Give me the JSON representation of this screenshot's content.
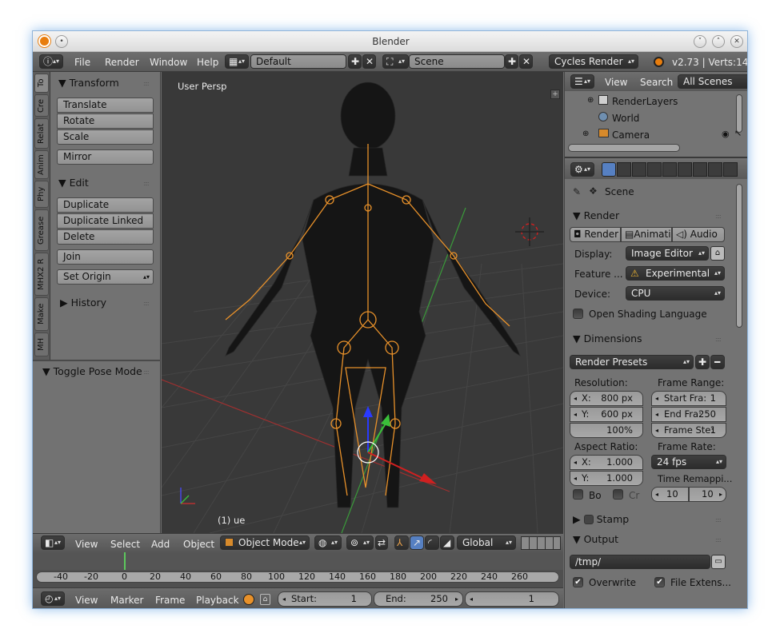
{
  "window": {
    "title": "Blender"
  },
  "info_header": {
    "menus": [
      "File",
      "Render",
      "Window",
      "Help"
    ],
    "layout": "Default",
    "scene": "Scene",
    "engine": "Cycles Render",
    "version_stats": "v2.73 | Verts:14,4"
  },
  "left_tabs": [
    "To",
    "Cre",
    "Relat",
    "Anim",
    "Phy",
    "Grease",
    "MHX2 R",
    "Make",
    "MH"
  ],
  "tool_shelf": {
    "transform_title": "Transform",
    "transform_buttons": [
      "Translate",
      "Rotate",
      "Scale"
    ],
    "mirror": "Mirror",
    "edit_title": "Edit",
    "edit_buttons": [
      "Duplicate",
      "Duplicate Linked",
      "Delete"
    ],
    "join": "Join",
    "set_origin": "Set Origin",
    "history": "History",
    "toggle_pose": "Toggle Pose Mode"
  },
  "viewport": {
    "label": "User Persp",
    "object_label": "(1) ue"
  },
  "viewport_header": {
    "menus": [
      "View",
      "Select",
      "Add",
      "Object"
    ],
    "mode": "Object Mode",
    "orientation": "Global"
  },
  "timeline": {
    "ticks": [
      "-40",
      "-20",
      "0",
      "20",
      "40",
      "60",
      "80",
      "100",
      "120",
      "140",
      "160",
      "180",
      "200",
      "220",
      "240",
      "260"
    ],
    "menus": [
      "View",
      "Marker",
      "Frame",
      "Playback"
    ],
    "start_label": "Start:",
    "start": "1",
    "end_label": "End:",
    "end": "250",
    "current": "1"
  },
  "outliner": {
    "menus": [
      "View",
      "Search"
    ],
    "filter": "All Scenes",
    "items": [
      "RenderLayers",
      "World",
      "Camera"
    ]
  },
  "properties": {
    "scene_name": "Scene",
    "render_title": "Render",
    "render_buttons": [
      "Render",
      "Animatio",
      "Audio"
    ],
    "display_label": "Display:",
    "display_value": "Image Editor",
    "feature_label": "Feature ...",
    "feature_value": "Experimental",
    "device_label": "Device:",
    "device_value": "CPU",
    "osl": "Open Shading Language",
    "dimensions_title": "Dimensions",
    "render_presets": "Render Presets",
    "resolution_label": "Resolution:",
    "res_x": "X:",
    "res_x_val": "800 px",
    "res_y": "Y:",
    "res_y_val": "600 px",
    "res_pct": "100%",
    "frame_range_label": "Frame Range:",
    "start_frame": "Start Fra:",
    "start_frame_val": "1",
    "end_frame": "End Fra:",
    "end_frame_val": "250",
    "frame_step": "Frame Ste:",
    "frame_step_val": "1",
    "aspect_label": "Aspect Ratio:",
    "asp_x": "X:",
    "asp_x_val": "1.000",
    "asp_y": "Y:",
    "asp_y_val": "1.000",
    "frame_rate_label": "Frame Rate:",
    "fps": "24 fps",
    "time_remap": "Time Remappi...",
    "remap_old": "10",
    "remap_new": "10",
    "border": "Bo",
    "crop": "Cr",
    "stamp_title": "Stamp",
    "output_title": "Output",
    "output_path": "/tmp/",
    "overwrite": "Overwrite",
    "file_ext": "File Extens..."
  }
}
